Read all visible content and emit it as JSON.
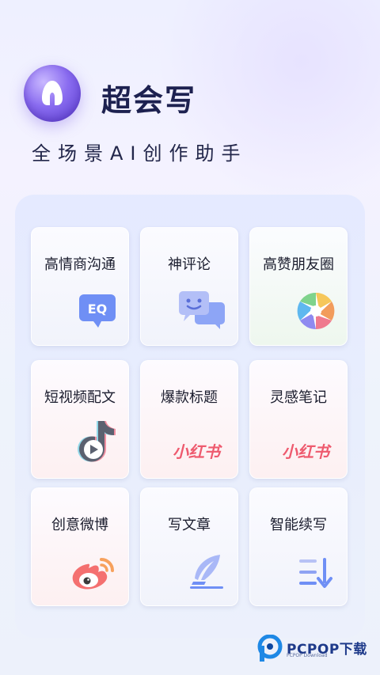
{
  "app": {
    "title": "超会写",
    "tagline": "全场景AI创作助手",
    "logo_icon": "ai-logo-icon"
  },
  "features": [
    {
      "label": "高情商沟通",
      "icon": "eq-bubble-icon"
    },
    {
      "label": "神评论",
      "icon": "chat-bubbles-icon"
    },
    {
      "label": "高赞朋友圈",
      "icon": "camera-aperture-icon"
    },
    {
      "label": "短视频配文",
      "icon": "video-note-icon"
    },
    {
      "label": "爆款标题",
      "icon": "xiaohongshu-logo",
      "logo_text": "小红书"
    },
    {
      "label": "灵感笔记",
      "icon": "xiaohongshu-logo",
      "logo_text": "小红书"
    },
    {
      "label": "创意微博",
      "icon": "weibo-icon"
    },
    {
      "label": "写文章",
      "icon": "feather-pen-icon"
    },
    {
      "label": "智能续写",
      "icon": "sort-lines-icon"
    }
  ],
  "watermark": {
    "brand": "PCPOP下载",
    "sub": "PCPOP Download"
  },
  "colors": {
    "accent": "#7b5ff0",
    "icon_blue": "#6f8ff5",
    "xhs_red": "#ee5a6e"
  }
}
